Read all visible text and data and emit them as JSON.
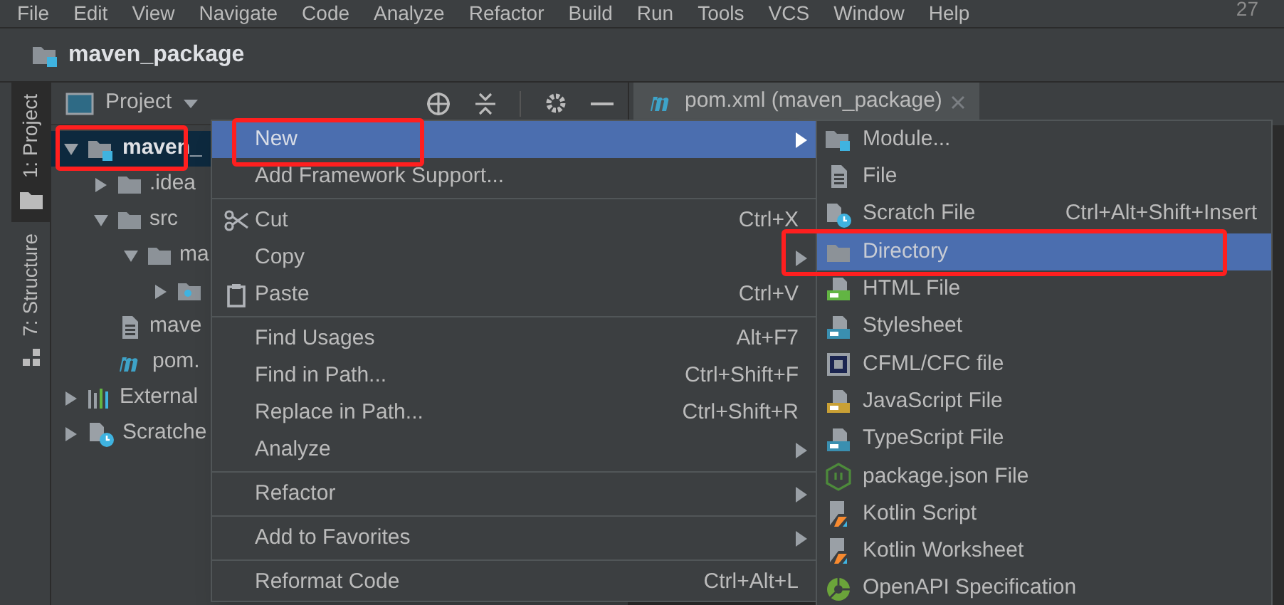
{
  "menu_bar": [
    "File",
    "Edit",
    "View",
    "Navigate",
    "Code",
    "Analyze",
    "Refactor",
    "Build",
    "Run",
    "Tools",
    "VCS",
    "Window",
    "Help"
  ],
  "corner_text": "27",
  "title": "maven_package",
  "tool_stripe": [
    {
      "label": "1: Project",
      "selected": true
    },
    {
      "label": "7: Structure",
      "selected": false
    }
  ],
  "project_panel": {
    "title": "Project"
  },
  "editor_tab": {
    "label": "pom.xml (maven_package)"
  },
  "tree": [
    {
      "label": "maven_",
      "kind": "module",
      "expanded": true,
      "selected": true,
      "outlined": true,
      "children": [
        {
          "label": ".idea",
          "kind": "folder",
          "expanded": false,
          "selected": false,
          "outlined": false
        },
        {
          "label": "src",
          "kind": "folder",
          "expanded": true,
          "selected": false,
          "outlined": false,
          "children": [
            {
              "label": "ma",
              "kind": "folder",
              "expanded": true,
              "selected": false,
              "outlined": false,
              "children": [
                {
                  "kind": "package",
                  "expanded": false,
                  "selected": false,
                  "outlined": false
                }
              ]
            }
          ]
        },
        {
          "label": "mave",
          "kind": "file",
          "selected": false,
          "outlined": false
        },
        {
          "label": "pom.",
          "kind": "maven",
          "selected": false,
          "outlined": false
        }
      ]
    },
    {
      "label": "External",
      "kind": "library",
      "expanded": false,
      "selected": false,
      "outlined": false
    },
    {
      "label": "Scratche",
      "kind": "scratch",
      "expanded": false,
      "selected": false,
      "outlined": false
    }
  ],
  "context_menu": [
    {
      "kind": "item",
      "label": "New",
      "submenu": true,
      "selected": true,
      "outlined": true
    },
    {
      "kind": "item",
      "label": "Add Framework Support...",
      "selected": false,
      "outlined": false
    },
    {
      "kind": "separator"
    },
    {
      "kind": "cut",
      "label": "Cut",
      "shortcut": "Ctrl+X",
      "selected": false,
      "outlined": false
    },
    {
      "kind": "item",
      "label": "Copy",
      "submenu": true,
      "selected": false,
      "outlined": false
    },
    {
      "kind": "paste",
      "label": "Paste",
      "shortcut": "Ctrl+V",
      "selected": false,
      "outlined": false
    },
    {
      "kind": "separator"
    },
    {
      "kind": "item",
      "label": "Find Usages",
      "shortcut": "Alt+F7",
      "selected": false,
      "outlined": false
    },
    {
      "kind": "item",
      "label": "Find in Path...",
      "shortcut": "Ctrl+Shift+F",
      "selected": false,
      "outlined": false
    },
    {
      "kind": "item",
      "label": "Replace in Path...",
      "shortcut": "Ctrl+Shift+R",
      "selected": false,
      "outlined": false
    },
    {
      "kind": "item",
      "label": "Analyze",
      "submenu": true,
      "selected": false,
      "outlined": false
    },
    {
      "kind": "separator"
    },
    {
      "kind": "item",
      "label": "Refactor",
      "submenu": true,
      "selected": false,
      "outlined": false
    },
    {
      "kind": "separator"
    },
    {
      "kind": "item",
      "label": "Add to Favorites",
      "submenu": true,
      "selected": false,
      "outlined": false
    },
    {
      "kind": "separator"
    },
    {
      "kind": "item",
      "label": "Reformat Code",
      "shortcut": "Ctrl+Alt+L",
      "selected": false,
      "outlined": false
    }
  ],
  "new_submenu": [
    {
      "label": "Module...",
      "kind": "module",
      "selected": false,
      "outlined": false
    },
    {
      "label": "File",
      "kind": "file",
      "selected": false,
      "outlined": false
    },
    {
      "label": "Scratch File",
      "kind": "scratch",
      "shortcut": "Ctrl+Alt+Shift+Insert",
      "selected": false,
      "outlined": false
    },
    {
      "label": "Directory",
      "kind": "folder",
      "selected": true,
      "outlined": true
    },
    {
      "label": "HTML File",
      "kind": "html",
      "selected": false,
      "outlined": false
    },
    {
      "label": "Stylesheet",
      "kind": "css",
      "selected": false,
      "outlined": false
    },
    {
      "label": "CFML/CFC file",
      "kind": "cf",
      "selected": false,
      "outlined": false
    },
    {
      "label": "JavaScript File",
      "kind": "js",
      "selected": false,
      "outlined": false
    },
    {
      "label": "TypeScript File",
      "kind": "ts",
      "selected": false,
      "outlined": false
    },
    {
      "label": "package.json File",
      "kind": "node",
      "selected": false,
      "outlined": false
    },
    {
      "label": "Kotlin Script",
      "kind": "kotlin",
      "selected": false,
      "outlined": false
    },
    {
      "label": "Kotlin Worksheet",
      "kind": "kotlin",
      "selected": false,
      "outlined": false
    },
    {
      "label": "OpenAPI Specification",
      "kind": "openapi",
      "selected": false,
      "outlined": false
    }
  ]
}
